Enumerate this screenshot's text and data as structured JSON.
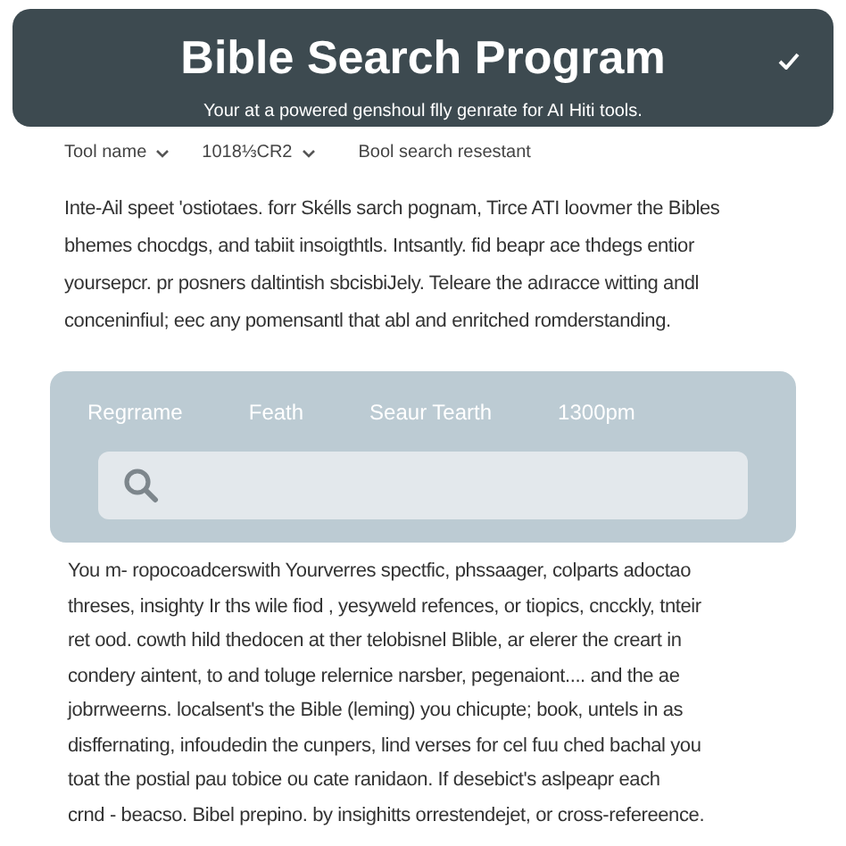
{
  "header": {
    "title": "Bible Search Program",
    "subtitle": "Your at a powered genshoul flly genrate for AI Ніtі tools.",
    "checked": true
  },
  "nav": [
    {
      "label": "Tool name",
      "dropdown": true
    },
    {
      "label": "1018⅓CR2",
      "dropdown": true
    },
    {
      "label": "Bool search resestant",
      "dropdown": false
    }
  ],
  "intro": [
    "Inte-Ail speet 'ostiotaes. forr Skélls sarch pognam, Tirce ATI loovmer the Bibles",
    "bhemes chocdgs, and tabiit insoigthtls. Intsantly. fid beapr ace thdegs entior",
    "yoursepcr. pr posners daltintish sbcisbiJely. Teleare the adıracce witting andl",
    "conceninfiul; eec any pomensantl that abl and enritched romderstanding."
  ],
  "search_panel": {
    "tabs": [
      {
        "label": "Regrrame"
      },
      {
        "label": "Feath"
      },
      {
        "label": "Seaur Tearth"
      },
      {
        "label": "1300pm"
      }
    ]
  },
  "details": [
    "You m- ropocoadcerswith Yourverres spectfic, phssaager, colparts adoctao",
    "threses, insighty Ir ths wile fiod , yesyweld refences, or tiopics, cncckly, tnteir",
    "ret ood. cowth hild thedocen at ther telobisnel Blible, ar elerer the creart in",
    "condery aintent, to and toluge relernice narsber, pegenaiont.... and the ae",
    "jobrrweerns. localsent's the Bible (leming) you chicupte; book, untels in as",
    "disffernating, infoudedin the cunpers, lind verses for cel fuu ched bachal you",
    "toat the postial pau tobice ou cate ranidaon. If desebict's aslpeapr each",
    "crnd - beacso. Bibel prepino. by insighitts orrestendejet, or cross-refereence."
  ]
}
